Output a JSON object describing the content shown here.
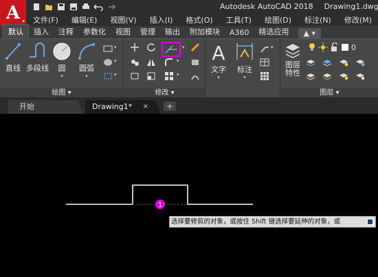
{
  "app": {
    "logo_letter": "A",
    "title": "Autodesk AutoCAD 2018",
    "file": "Drawing1.dwg"
  },
  "quick_access": [
    "new-icon",
    "open-icon",
    "save-icon",
    "saveas-icon",
    "print-icon",
    "undo-icon",
    "redo-icon"
  ],
  "menu": [
    "文件(F)",
    "编辑(E)",
    "视图(V)",
    "插入(I)",
    "格式(O)",
    "工具(T)",
    "绘图(D)",
    "标注(N)",
    "修改(M)"
  ],
  "ribbon_tabs": [
    "默认",
    "插入",
    "注释",
    "参数化",
    "视图",
    "管理",
    "输出",
    "附加模块",
    "A360",
    "精选应用"
  ],
  "ribbon_extra": "▲ ▾",
  "draw_panel": {
    "title": "绘图 ▾",
    "tools": {
      "line": "直线",
      "polyline": "多段线",
      "circle": "圆",
      "arc": "圆弧"
    }
  },
  "modify_panel": {
    "title": "修改 ▾"
  },
  "annotation_panel": {
    "text": "文字",
    "dimension": "标注"
  },
  "layers_panel": {
    "properties": "图层特性",
    "title": "图层 ▾",
    "layer_value": "0"
  },
  "doc_tabs": {
    "start": "开始",
    "drawing": "Drawing1*",
    "close": "×",
    "add": "+"
  },
  "canvas": {
    "marker": "1",
    "prompt": "选择要修剪的对象，或按住 Shift 键选择要延伸的对象，或"
  },
  "colors": {
    "highlight": "#e000e0",
    "marker": "#e000e0",
    "logo": "#c8161d",
    "ribbon": "#474747",
    "titlebar": "#2d2d2d"
  }
}
